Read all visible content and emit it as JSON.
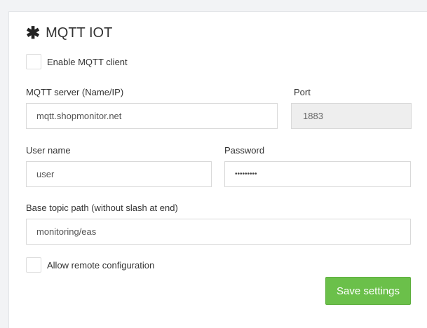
{
  "panel": {
    "title": "MQTT IOT",
    "title_icon": "asterisk-icon"
  },
  "enable_mqtt": {
    "label": "Enable MQTT client",
    "checked": false
  },
  "server": {
    "label": "MQTT server (Name/IP)",
    "value": "mqtt.shopmonitor.net"
  },
  "port": {
    "label": "Port",
    "value": "1883"
  },
  "username": {
    "label": "User name",
    "value": "user"
  },
  "password": {
    "label": "Password",
    "value": "•••••••••"
  },
  "base_topic": {
    "label": "Base topic path (without slash at end)",
    "value": "monitoring/eas"
  },
  "remote_config": {
    "label": "Allow remote configuration",
    "checked": false
  },
  "actions": {
    "save_label": "Save settings",
    "save_color": "#6bc04a"
  }
}
